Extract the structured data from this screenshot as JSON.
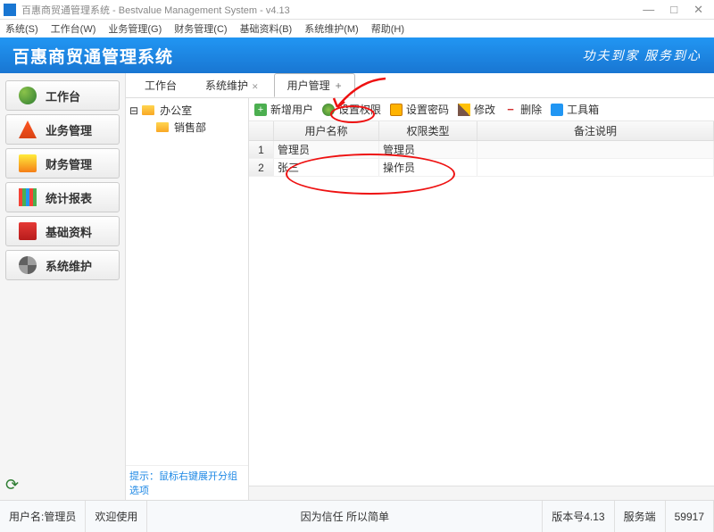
{
  "window": {
    "title": "百惠商贸通管理系统 - Bestvalue Management System - v4.13"
  },
  "menubar": [
    "系统(S)",
    "工作台(W)",
    "业务管理(G)",
    "财务管理(C)",
    "基础资料(B)",
    "系统维护(M)",
    "帮助(H)"
  ],
  "banner": {
    "logo": "百惠商贸通管理系统",
    "slogan": "功夫到家 服务到心"
  },
  "sidebar": {
    "items": [
      {
        "label": "工作台"
      },
      {
        "label": "业务管理"
      },
      {
        "label": "财务管理"
      },
      {
        "label": "统计报表"
      },
      {
        "label": "基础资料"
      },
      {
        "label": "系统维护"
      }
    ]
  },
  "tabs": [
    {
      "label": "工作台",
      "closable": false,
      "active": false
    },
    {
      "label": "系统维护",
      "closable": true,
      "active": false
    },
    {
      "label": "用户管理",
      "closable": false,
      "active": true,
      "addable": true
    }
  ],
  "tree": {
    "items": [
      {
        "label": "办公室"
      },
      {
        "label": "销售部"
      }
    ],
    "hint": "提示：鼠标右键展开分组选项"
  },
  "toolbar": {
    "add": "新增用户",
    "perm": "设置权限",
    "pwd": "设置密码",
    "edit": "修改",
    "del": "删除",
    "tools": "工具箱"
  },
  "grid": {
    "headers": {
      "name": "用户名称",
      "role": "权限类型",
      "note": "备注说明"
    },
    "rows": [
      {
        "n": "1",
        "name": "管理员",
        "role": "管理员",
        "note": ""
      },
      {
        "n": "2",
        "name": "张三",
        "role": "操作员",
        "note": ""
      }
    ]
  },
  "status": {
    "user_label": "用户名:管理员",
    "welcome": "欢迎使用",
    "motto": "因为信任 所以简单",
    "version": "版本号4.13",
    "server": "服务端",
    "port": "59917"
  }
}
